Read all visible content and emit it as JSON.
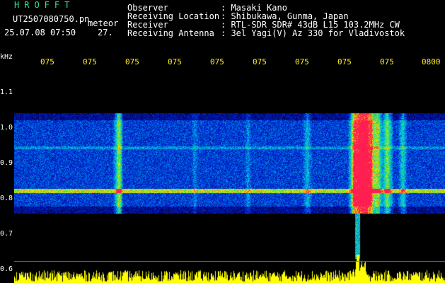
{
  "app_name": "HROFFT",
  "file_name": "UT2507080750.pn",
  "event_label": "meteor",
  "datetime": "25.07.08 07:50",
  "frame_count": "27.",
  "info": [
    {
      "key": "Observer",
      "value": ": Masaki Kano"
    },
    {
      "key": "Receiving Location",
      "value": ": Shibukawa, Gunma, Japan"
    },
    {
      "key": "Receiver",
      "value": ": RTL-SDR SDR# 43dB L15 103.2MHz CW"
    },
    {
      "key": "Receiving Antenna",
      "value": ": 3el Yagi(V) Az 330 for Vladivostok"
    }
  ],
  "y_axis": {
    "unit": "kHz",
    "ticks": [
      "1.1",
      "1.0",
      "0.9",
      "0.8",
      "0.7",
      "0.6"
    ]
  },
  "x_axis": {
    "ticks": [
      "075",
      "075",
      "075",
      "075",
      "075",
      "075",
      "075",
      "075",
      "075",
      "0800"
    ]
  },
  "colors": {
    "background": "#000000",
    "axis_text": "#ffee22",
    "app_title": "#22ee88",
    "header_text": "#ffffff",
    "amplitude": "#ffff00"
  }
}
